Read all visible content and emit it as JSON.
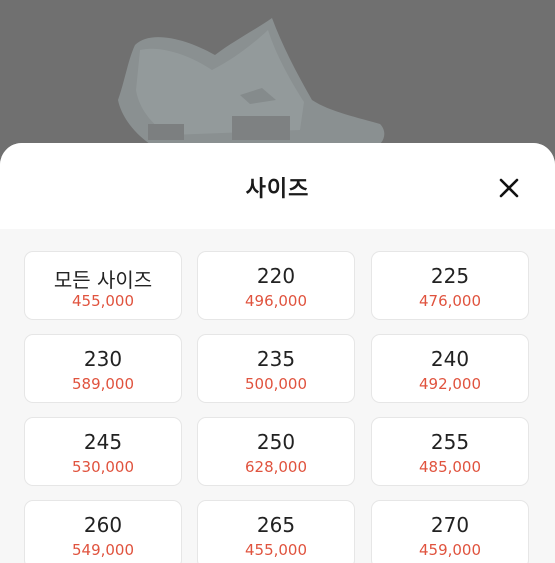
{
  "sheet": {
    "title": "사이즈",
    "close_icon": "close-icon"
  },
  "colors": {
    "backdrop": "#707070",
    "price": "#e0533e",
    "card_border": "#e6e6e6"
  },
  "sizes": [
    {
      "label": "모든 사이즈",
      "price": "455,000"
    },
    {
      "label": "220",
      "price": "496,000"
    },
    {
      "label": "225",
      "price": "476,000"
    },
    {
      "label": "230",
      "price": "589,000"
    },
    {
      "label": "235",
      "price": "500,000"
    },
    {
      "label": "240",
      "price": "492,000"
    },
    {
      "label": "245",
      "price": "530,000"
    },
    {
      "label": "250",
      "price": "628,000"
    },
    {
      "label": "255",
      "price": "485,000"
    },
    {
      "label": "260",
      "price": "549,000"
    },
    {
      "label": "265",
      "price": "455,000"
    },
    {
      "label": "270",
      "price": "459,000"
    }
  ]
}
